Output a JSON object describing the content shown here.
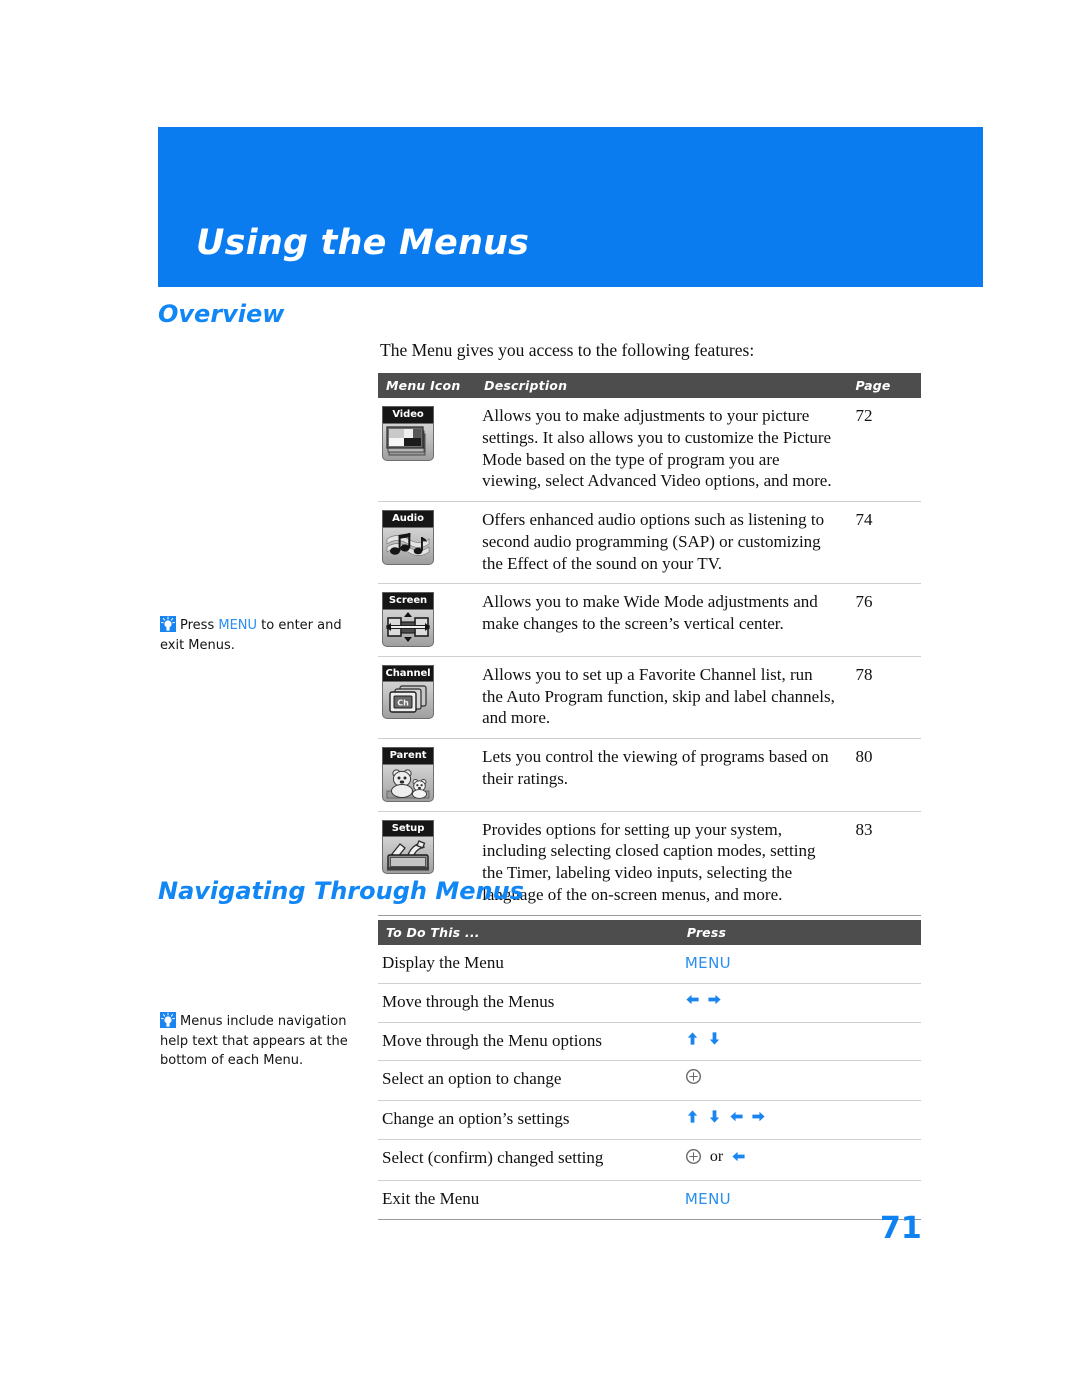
{
  "chapter": {
    "title": "Using the Menus",
    "banner_color": "#0a7cf0"
  },
  "sections": {
    "overview": {
      "heading": "Overview",
      "intro": "The Menu gives you access to the following features:"
    },
    "navigating": {
      "heading": "Navigating Through Menus"
    }
  },
  "menu_table": {
    "headers": {
      "icon": "Menu Icon",
      "description": "Description",
      "page": "Page"
    },
    "rows": [
      {
        "icon_label": "Video",
        "icon_name": "video-menu-icon",
        "description": "Allows you to make adjustments to your picture settings. It also allows you to customize the Picture Mode based on the type of program you are viewing, select Advanced Video options, and more.",
        "page": "72"
      },
      {
        "icon_label": "Audio",
        "icon_name": "audio-menu-icon",
        "description": "Offers enhanced audio options such as listening to second audio programming (SAP) or customizing the Effect of the sound on your TV.",
        "page": "74"
      },
      {
        "icon_label": "Screen",
        "icon_name": "screen-menu-icon",
        "description": "Allows you to make Wide Mode adjustments and make changes to the screen’s vertical center.",
        "page": "76"
      },
      {
        "icon_label": "Channel",
        "icon_name": "channel-menu-icon",
        "description": "Allows you to set up a Favorite Channel list, run the Auto Program function, skip and label channels, and more.",
        "page": "78"
      },
      {
        "icon_label": "Parent",
        "icon_name": "parent-menu-icon",
        "description": "Lets you control the viewing of programs based on their ratings.",
        "page": "80"
      },
      {
        "icon_label": "Setup",
        "icon_name": "setup-menu-icon",
        "description": "Provides options for  setting up your system, including selecting closed caption modes, setting the Timer, labeling video inputs, selecting the language of the on-screen menus, and more.",
        "page": "83"
      }
    ]
  },
  "nav_table": {
    "headers": {
      "todo": "To Do This ...",
      "press": "Press"
    },
    "rows": [
      {
        "todo": "Display the Menu",
        "press_text": "MENU",
        "press_keys": []
      },
      {
        "todo": "Move through the Menus",
        "press_text": "",
        "press_keys": [
          "left-arrow",
          "right-arrow"
        ]
      },
      {
        "todo": "Move through the Menu options",
        "press_text": "",
        "press_keys": [
          "up-arrow",
          "down-arrow"
        ]
      },
      {
        "todo": "Select an option to change",
        "press_text": "",
        "press_keys": [
          "select-circle"
        ]
      },
      {
        "todo": "Change an option’s settings",
        "press_text": "",
        "press_keys": [
          "up-arrow",
          "down-arrow",
          "left-arrow",
          "right-arrow"
        ]
      },
      {
        "todo": "Select (confirm) changed setting",
        "press_text": "",
        "press_keys": [
          "select-circle",
          "or",
          "left-arrow"
        ]
      },
      {
        "todo": "Exit the Menu",
        "press_text": "MENU",
        "press_keys": []
      }
    ],
    "or_word": "or"
  },
  "margin_notes": [
    {
      "icon": "tip-lightbulb-icon",
      "before": "Press ",
      "key": "MENU",
      "after": " to enter and exit Menus."
    },
    {
      "icon": "tip-lightbulb-icon",
      "before": "",
      "key": "",
      "after": "Menus include navigation help text that appears at the bottom of each Menu."
    }
  ],
  "page_number": "71",
  "colors": {
    "accent_blue": "#0a7cf0",
    "heading_blue": "#1186f5",
    "key_blue": "#2a8ef0",
    "table_header_gray": "#4d4d4d"
  }
}
